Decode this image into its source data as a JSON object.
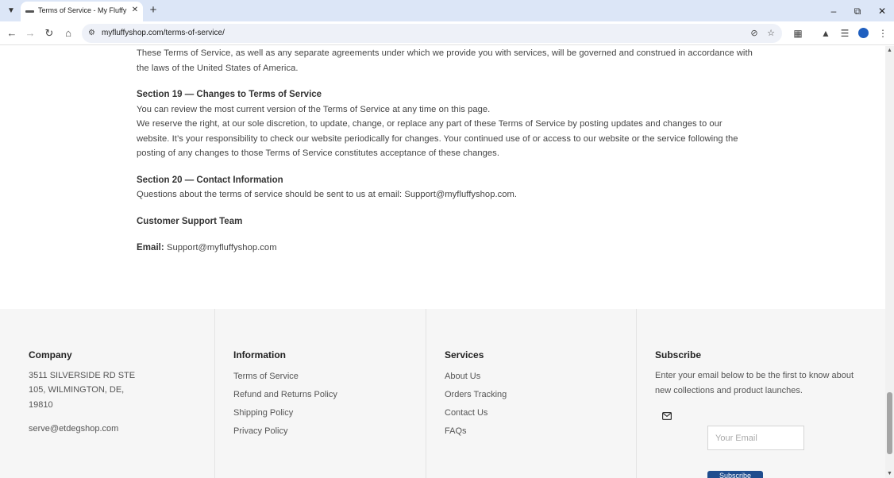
{
  "browser": {
    "tab_title": "Terms of Service - My Fluffy Sh",
    "url": "myfluffyshop.com/terms-of-service/"
  },
  "content": {
    "intro_paragraph": "These Terms of Service, as well as any separate agreements under which we provide you with services, will be governed and construed in accordance with the laws of the United States of America.",
    "section19": {
      "heading": "Section 19 — Changes to Terms of Service",
      "line1": "You can review the most current version of the Terms of Service at any time on this page.",
      "line2": "We reserve the right, at our sole discretion, to update, change, or replace any part of these Terms of Service by posting updates and changes to our website. It’s your responsibility to check our website periodically for changes. Your continued use of or access to our website or the service following the posting of any changes to those Terms of Service constitutes acceptance of these changes."
    },
    "section20": {
      "heading": "Section 20 — Contact Information",
      "text": "Questions about the terms of service should be sent to us at email: Support@myfluffyshop.com."
    },
    "support_team": "Customer Support Team",
    "email_label": "Email:",
    "email_value": "Support@myfluffyshop.com"
  },
  "footer": {
    "company": {
      "title": "Company",
      "address_line1": "3511 SILVERSIDE RD STE",
      "address_line2": "105, WILMINGTON, DE,",
      "address_line3": "19810",
      "email": "serve@etdegshop.com"
    },
    "information": {
      "title": "Information",
      "links": [
        "Terms of Service",
        "Refund and Returns Policy",
        "Shipping Policy",
        "Privacy Policy"
      ]
    },
    "services": {
      "title": "Services",
      "links": [
        "About Us",
        "Orders Tracking",
        "Contact Us",
        "FAQs"
      ]
    },
    "subscribe": {
      "title": "Subscribe",
      "description": "Enter your email below to be the first to know about new collections and product launches.",
      "placeholder": "Your Email",
      "button_label": "Subscribe"
    }
  },
  "colors": {
    "tabbar": "#dce6f7",
    "footer_bg": "#f6f6f6",
    "button": "#1f4d8e"
  }
}
